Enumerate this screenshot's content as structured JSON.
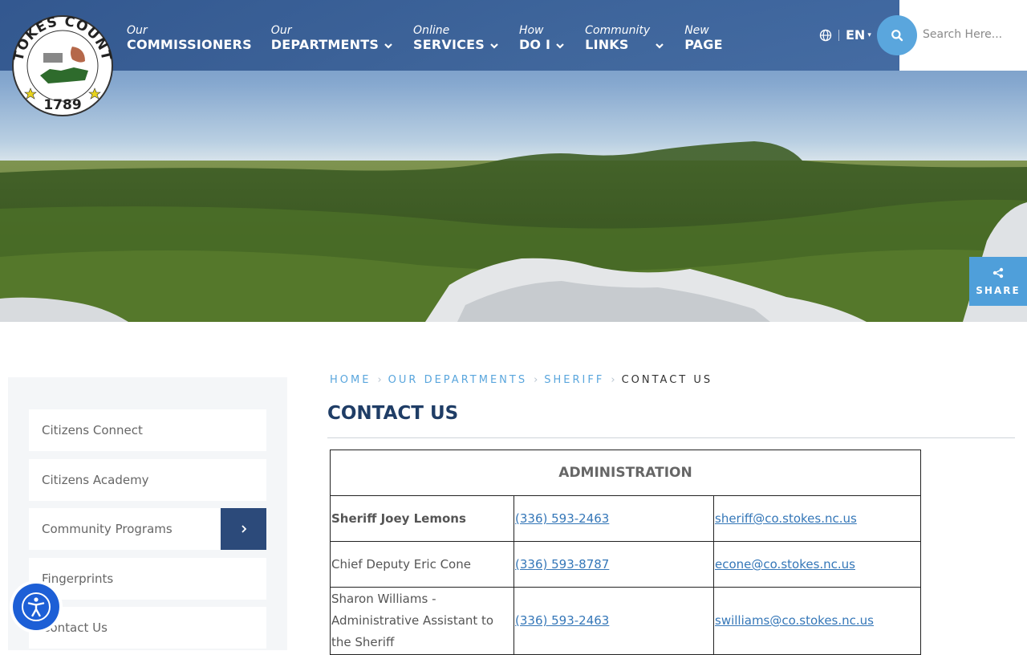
{
  "header": {
    "logo_text": "STOKES COUNTY 1789",
    "nav": [
      {
        "small": "Our",
        "big": "COMMISSIONERS",
        "has_dropdown": false
      },
      {
        "small": "Our",
        "big": "DEPARTMENTS",
        "has_dropdown": true
      },
      {
        "small": "Online",
        "big": "SERVICES",
        "has_dropdown": true
      },
      {
        "small": "How",
        "big": "DO I",
        "has_dropdown": true
      },
      {
        "small": "Community",
        "big": "LINKS",
        "has_dropdown": true
      },
      {
        "small": "New",
        "big": "PAGE",
        "has_dropdown": false
      }
    ],
    "language": "EN",
    "search_placeholder": "Search Here..."
  },
  "share": {
    "label": "SHARE"
  },
  "sidebar": {
    "items": [
      {
        "label": "Citizens Connect"
      },
      {
        "label": "Citizens Academy"
      },
      {
        "label": "Community Programs"
      },
      {
        "label": "Fingerprints"
      },
      {
        "label": "Contact Us"
      }
    ]
  },
  "breadcrumb": {
    "items": [
      "HOME",
      "OUR DEPARTMENTS",
      "SHERIFF"
    ],
    "current": "CONTACT US"
  },
  "page_title": "CONTACT US",
  "table": {
    "heading": "ADMINISTRATION",
    "rows": [
      {
        "name": "Sheriff Joey Lemons",
        "phone": "(336) 593-2463",
        "email": "sheriff@co.stokes.nc.us"
      },
      {
        "name": "Chief Deputy Eric Cone",
        "phone": "(336) 593-8787",
        "email": "econe@co.stokes.nc.us"
      },
      {
        "name": "Sharon Williams - Administrative Assistant to the Sheriff",
        "phone": "(336) 593-2463",
        "email": "swilliams@co.stokes.nc.us"
      }
    ]
  },
  "colors": {
    "header_blue": "#2f548c",
    "accent_blue": "#5aa6dd",
    "title_navy": "#1f3d66",
    "sidebar_arrow": "#2c4a7a",
    "a11y_blue": "#1d5fd6"
  },
  "icons": [
    "globe-icon",
    "search-icon",
    "share-icon",
    "chevron-right-icon",
    "chevron-down-icon",
    "accessibility-icon"
  ]
}
